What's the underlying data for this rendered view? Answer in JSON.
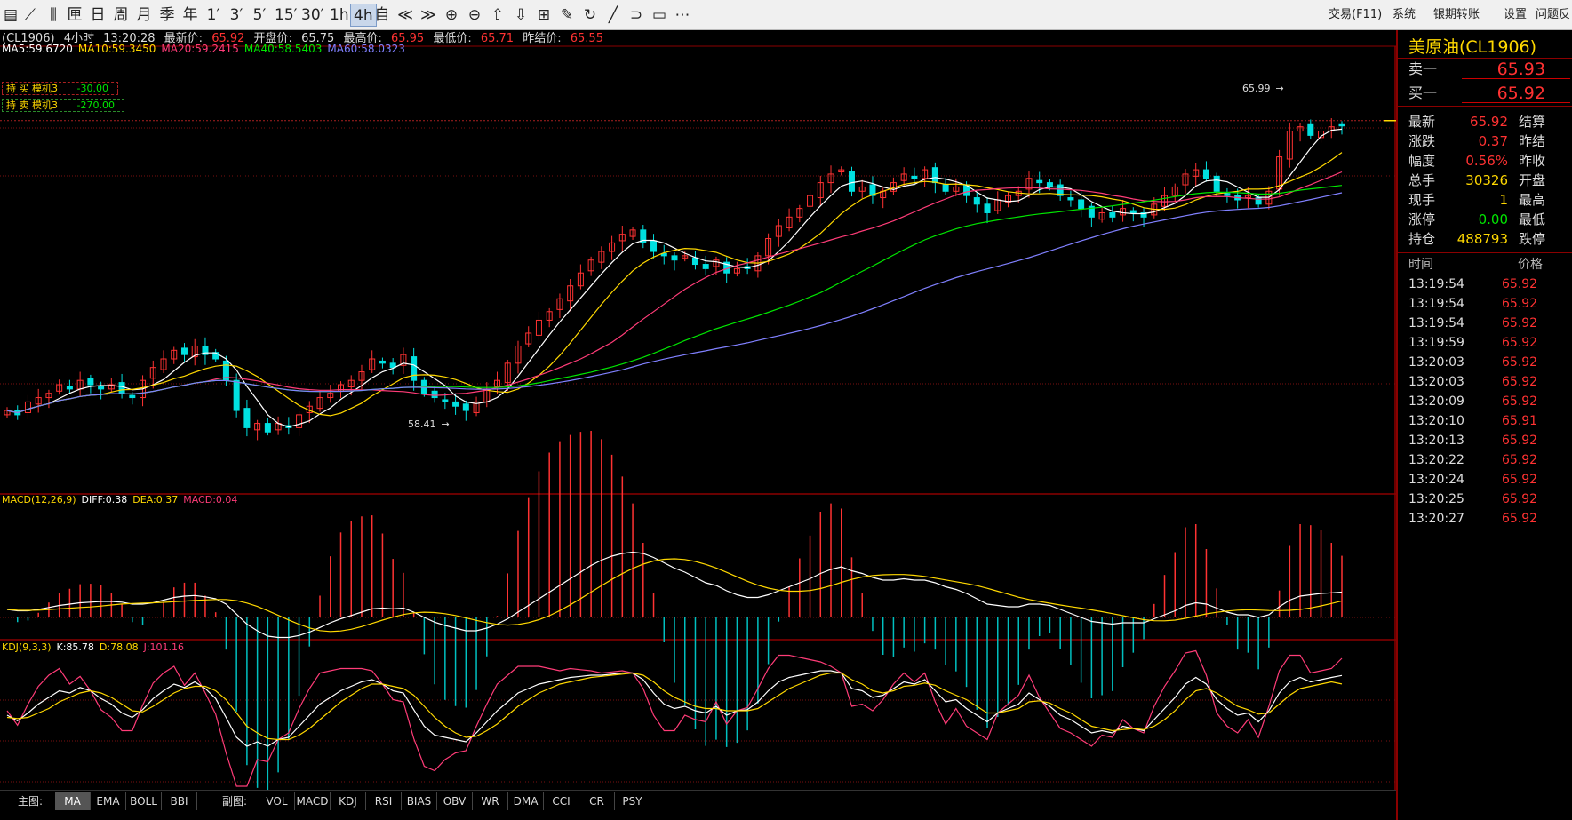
{
  "toolbar": {
    "buttons": [
      {
        "name": "kline-icon",
        "glyph": "▤"
      },
      {
        "name": "line-chart-icon",
        "glyph": "⟋"
      },
      {
        "name": "candle-icon",
        "glyph": "⫼"
      },
      {
        "name": "period-1y",
        "glyph": "匣"
      },
      {
        "name": "period-day",
        "glyph": "日"
      },
      {
        "name": "period-week",
        "glyph": "周"
      },
      {
        "name": "period-month",
        "glyph": "月"
      },
      {
        "name": "period-quarter",
        "glyph": "季"
      },
      {
        "name": "period-year",
        "glyph": "年"
      },
      {
        "name": "period-1min",
        "glyph": "1′"
      },
      {
        "name": "period-3min",
        "glyph": "3′"
      },
      {
        "name": "period-5min",
        "glyph": "5′"
      },
      {
        "name": "period-15min",
        "glyph": "15′"
      },
      {
        "name": "period-30min",
        "glyph": "30′"
      },
      {
        "name": "period-1h",
        "glyph": "1h"
      },
      {
        "name": "period-4h",
        "glyph": "4h"
      },
      {
        "name": "period-custom",
        "glyph": "自"
      },
      {
        "name": "scroll-left-icon",
        "glyph": "≪"
      },
      {
        "name": "scroll-right-icon",
        "glyph": "≫"
      },
      {
        "name": "zoom-in-icon",
        "glyph": "⊕"
      },
      {
        "name": "zoom-out-icon",
        "glyph": "⊖"
      },
      {
        "name": "up-arrow-icon",
        "glyph": "⇧"
      },
      {
        "name": "down-arrow-icon",
        "glyph": "⇩"
      },
      {
        "name": "grid-icon",
        "glyph": "⊞"
      },
      {
        "name": "draw-icon",
        "glyph": "✎"
      },
      {
        "name": "refresh-icon",
        "glyph": "↻"
      },
      {
        "name": "line-draw-icon",
        "glyph": "╱"
      },
      {
        "name": "arc-icon",
        "glyph": "⊃"
      },
      {
        "name": "note-icon",
        "glyph": "▭"
      },
      {
        "name": "more-icon",
        "glyph": "⋯"
      }
    ],
    "active_button": "4h",
    "menu": [
      "交易(F11)",
      "系统",
      "银期转账",
      "设置",
      "问题反馈"
    ]
  },
  "header": {
    "symbol": "(CL1906)",
    "period": "4小时",
    "time": "13:20:28",
    "latest_label": "最新价:",
    "latest_value": "65.92",
    "open_label": "开盘价:",
    "open_value": "65.75",
    "high_label": "最高价:",
    "high_value": "65.95",
    "low_label": "最低价:",
    "low_value": "65.71",
    "settle_label": "昨结价:",
    "settle_value": "65.55"
  },
  "ma_legend": [
    {
      "text": "MA5:59.6720",
      "color": "#ffffff"
    },
    {
      "text": "MA10:59.3450",
      "color": "#ffd800"
    },
    {
      "text": "MA20:59.2415",
      "color": "#ff3c78"
    },
    {
      "text": "MA40:58.5403",
      "color": "#00e600"
    },
    {
      "text": "MA60:58.0323",
      "color": "#8080ff"
    }
  ],
  "positions": [
    {
      "label": "持 买  模机3",
      "value": "-30.00"
    },
    {
      "label": "持 卖  模机3",
      "value": "-270.00"
    }
  ],
  "annotations": {
    "high_marker": "65.99",
    "low_marker": "58.41"
  },
  "macd_legend": [
    {
      "text": "MACD(12,26,9)",
      "color": "#ffd800"
    },
    {
      "text": "DIFF:0.38",
      "color": "#ffffff"
    },
    {
      "text": "DEA:0.37",
      "color": "#ffd800"
    },
    {
      "text": "MACD:0.04",
      "color": "#ff3c78"
    }
  ],
  "kdj_legend": [
    {
      "text": "KDJ(9,3,3)",
      "color": "#ffd800"
    },
    {
      "text": "K:85.78",
      "color": "#ffffff"
    },
    {
      "text": "D:78.08",
      "color": "#ffd800"
    },
    {
      "text": "J:101.16",
      "color": "#ff3c78"
    }
  ],
  "bottom_tabs": {
    "main_label": "主图:",
    "main": [
      "MA",
      "EMA",
      "BOLL",
      "BBI"
    ],
    "main_selected": "MA",
    "sub_label": "副图:",
    "sub": [
      "VOL",
      "MACD",
      "KDJ",
      "RSI",
      "BIAS",
      "OBV",
      "WR",
      "DMA",
      "CCI",
      "CR",
      "PSY"
    ]
  },
  "quote_panel": {
    "title": "美原油(CL1906)",
    "ask_label": "卖一",
    "ask_value": "65.93",
    "bid_label": "买一",
    "bid_value": "65.92",
    "stats": [
      {
        "label": "最新",
        "value": "65.92",
        "color": "#ff3232",
        "right": "结算"
      },
      {
        "label": "涨跌",
        "value": "0.37",
        "color": "#ff3232",
        "right": "昨结"
      },
      {
        "label": "幅度",
        "value": "0.56%",
        "color": "#ff3232",
        "right": "昨收"
      },
      {
        "label": "总手",
        "value": "30326",
        "color": "#ffd800",
        "right": "开盘"
      },
      {
        "label": "现手",
        "value": "1",
        "color": "#ffd800",
        "right": "最高"
      },
      {
        "label": "涨停",
        "value": "0.00",
        "color": "#00e600",
        "right": "最低"
      },
      {
        "label": "持仓",
        "value": "488793",
        "color": "#ffd800",
        "right": "跌停"
      }
    ],
    "ticks_header": {
      "time": "时间",
      "price": "价格"
    },
    "ticks": [
      {
        "time": "13:19:54",
        "price": "65.92"
      },
      {
        "time": "13:19:54",
        "price": "65.92"
      },
      {
        "time": "13:19:54",
        "price": "65.92"
      },
      {
        "time": "13:19:59",
        "price": "65.92"
      },
      {
        "time": "13:20:03",
        "price": "65.92"
      },
      {
        "time": "13:20:03",
        "price": "65.92"
      },
      {
        "time": "13:20:09",
        "price": "65.92"
      },
      {
        "time": "13:20:10",
        "price": "65.91"
      },
      {
        "time": "13:20:13",
        "price": "65.92"
      },
      {
        "time": "13:20:22",
        "price": "65.92"
      },
      {
        "time": "13:20:24",
        "price": "65.92"
      },
      {
        "time": "13:20:25",
        "price": "65.92"
      },
      {
        "time": "13:20:27",
        "price": "65.92"
      }
    ]
  },
  "chart_data": {
    "type": "candlestick",
    "price_range": [
      57.4,
      66.7
    ],
    "closes": [
      59.3,
      59.2,
      59.5,
      59.6,
      59.7,
      59.9,
      59.8,
      60.0,
      59.9,
      59.8,
      59.9,
      59.7,
      59.6,
      60.0,
      60.3,
      60.5,
      60.7,
      60.6,
      60.8,
      60.6,
      60.5,
      60.0,
      59.3,
      58.9,
      59.0,
      58.8,
      59.0,
      58.9,
      59.2,
      59.4,
      59.6,
      59.7,
      59.9,
      60.0,
      60.2,
      60.5,
      60.4,
      60.3,
      60.6,
      60.0,
      59.7,
      59.6,
      59.5,
      59.4,
      59.3,
      59.5,
      59.8,
      60.0,
      60.4,
      60.8,
      61.1,
      61.4,
      61.6,
      61.9,
      62.2,
      62.5,
      62.8,
      63.0,
      63.2,
      63.4,
      63.5,
      63.2,
      63.0,
      62.9,
      62.8,
      62.9,
      62.7,
      62.6,
      62.8,
      62.5,
      62.6,
      62.6,
      62.9,
      63.3,
      63.6,
      63.8,
      64.0,
      64.3,
      64.6,
      64.8,
      64.9,
      64.4,
      64.5,
      64.3,
      64.4,
      64.6,
      64.8,
      64.7,
      64.9,
      64.6,
      64.4,
      64.5,
      64.3,
      64.1,
      63.9,
      64.2,
      64.3,
      64.4,
      64.7,
      64.6,
      64.5,
      64.3,
      64.2,
      64.0,
      63.8,
      63.9,
      63.8,
      64.0,
      63.9,
      63.8,
      64.1,
      64.3,
      64.5,
      64.8,
      64.9,
      64.7,
      64.4,
      64.3,
      64.2,
      64.3,
      64.1,
      64.4,
      65.2,
      65.8,
      65.9,
      65.7,
      65.8,
      65.9,
      65.92
    ],
    "macd_diff": [
      0.12,
      0.1,
      0.1,
      0.12,
      0.15,
      0.18,
      0.2,
      0.22,
      0.23,
      0.24,
      0.24,
      0.23,
      0.2,
      0.2,
      0.22,
      0.26,
      0.3,
      0.32,
      0.33,
      0.31,
      0.28,
      0.2,
      0.05,
      -0.1,
      -0.2,
      -0.28,
      -0.3,
      -0.3,
      -0.27,
      -0.22,
      -0.15,
      -0.08,
      -0.02,
      0.03,
      0.08,
      0.13,
      0.14,
      0.13,
      0.14,
      0.08,
      0.0,
      -0.07,
      -0.12,
      -0.16,
      -0.2,
      -0.2,
      -0.16,
      -0.1,
      -0.02,
      0.08,
      0.18,
      0.28,
      0.38,
      0.48,
      0.58,
      0.68,
      0.78,
      0.86,
      0.92,
      0.96,
      0.98,
      0.96,
      0.9,
      0.82,
      0.74,
      0.68,
      0.6,
      0.52,
      0.48,
      0.4,
      0.34,
      0.3,
      0.3,
      0.34,
      0.4,
      0.46,
      0.52,
      0.58,
      0.66,
      0.72,
      0.76,
      0.7,
      0.66,
      0.6,
      0.56,
      0.56,
      0.58,
      0.56,
      0.56,
      0.52,
      0.46,
      0.42,
      0.36,
      0.28,
      0.2,
      0.18,
      0.16,
      0.16,
      0.2,
      0.2,
      0.18,
      0.12,
      0.06,
      0.0,
      -0.06,
      -0.08,
      -0.1,
      -0.08,
      -0.08,
      -0.08,
      -0.02,
      0.04,
      0.1,
      0.18,
      0.22,
      0.2,
      0.14,
      0.08,
      0.04,
      0.04,
      0.0,
      0.04,
      0.16,
      0.26,
      0.32,
      0.34,
      0.36,
      0.37,
      0.38
    ],
    "kdj_k": [
      50,
      45,
      52,
      60,
      66,
      72,
      70,
      75,
      72,
      65,
      60,
      52,
      48,
      55,
      65,
      72,
      78,
      75,
      80,
      74,
      65,
      48,
      30,
      22,
      26,
      22,
      28,
      30,
      40,
      50,
      60,
      66,
      72,
      76,
      80,
      82,
      78,
      72,
      70,
      55,
      40,
      32,
      30,
      28,
      26,
      34,
      44,
      54,
      62,
      70,
      74,
      78,
      80,
      82,
      84,
      85,
      86,
      86,
      87,
      88,
      88,
      82,
      70,
      60,
      56,
      58,
      54,
      52,
      58,
      50,
      54,
      55,
      62,
      72,
      80,
      84,
      86,
      88,
      90,
      90,
      88,
      74,
      72,
      66,
      68,
      74,
      80,
      78,
      82,
      72,
      62,
      64,
      56,
      50,
      44,
      52,
      56,
      60,
      70,
      64,
      58,
      50,
      46,
      40,
      34,
      36,
      34,
      40,
      38,
      36,
      46,
      56,
      66,
      78,
      84,
      78,
      64,
      56,
      50,
      52,
      44,
      54,
      70,
      80,
      84,
      80,
      82,
      84,
      85.78
    ],
    "kdj_d": [
      48,
      47,
      48,
      52,
      56,
      62,
      66,
      70,
      72,
      70,
      66,
      60,
      54,
      53,
      58,
      64,
      70,
      74,
      76,
      76,
      72,
      64,
      52,
      40,
      34,
      29,
      28,
      28,
      32,
      38,
      46,
      54,
      62,
      68,
      74,
      78,
      78,
      76,
      74,
      68,
      58,
      48,
      40,
      34,
      30,
      31,
      36,
      42,
      50,
      58,
      64,
      70,
      74,
      78,
      80,
      82,
      84,
      85,
      86,
      87,
      88,
      86,
      80,
      72,
      66,
      62,
      58,
      56,
      56,
      54,
      54,
      54,
      56,
      62,
      68,
      74,
      78,
      82,
      86,
      88,
      88,
      82,
      78,
      72,
      70,
      72,
      76,
      77,
      79,
      77,
      72,
      68,
      64,
      58,
      52,
      52,
      54,
      56,
      62,
      63,
      61,
      56,
      52,
      46,
      40,
      38,
      36,
      37,
      38,
      37,
      40,
      46,
      54,
      64,
      72,
      74,
      70,
      64,
      58,
      55,
      51,
      52,
      60,
      68,
      74,
      76,
      78,
      80,
      78.08
    ],
    "kdj_j": [
      54,
      41,
      60,
      76,
      86,
      92,
      78,
      85,
      72,
      55,
      48,
      36,
      36,
      59,
      79,
      88,
      94,
      77,
      88,
      70,
      51,
      16,
      -14,
      -14,
      10,
      8,
      28,
      34,
      56,
      74,
      88,
      90,
      92,
      92,
      92,
      90,
      78,
      64,
      62,
      29,
      4,
      0,
      10,
      16,
      18,
      40,
      60,
      78,
      86,
      94,
      94,
      94,
      92,
      90,
      92,
      91,
      90,
      88,
      89,
      90,
      88,
      74,
      50,
      36,
      36,
      50,
      46,
      44,
      62,
      42,
      54,
      57,
      74,
      92,
      104,
      104,
      102,
      100,
      98,
      94,
      88,
      58,
      60,
      54,
      64,
      78,
      88,
      80,
      88,
      62,
      42,
      56,
      40,
      34,
      28,
      52,
      60,
      68,
      86,
      66,
      52,
      38,
      34,
      28,
      22,
      32,
      30,
      46,
      38,
      34,
      58,
      76,
      90,
      106,
      108,
      86,
      52,
      40,
      34,
      46,
      30,
      58,
      90,
      104,
      104,
      88,
      90,
      92,
      101.16
    ]
  }
}
